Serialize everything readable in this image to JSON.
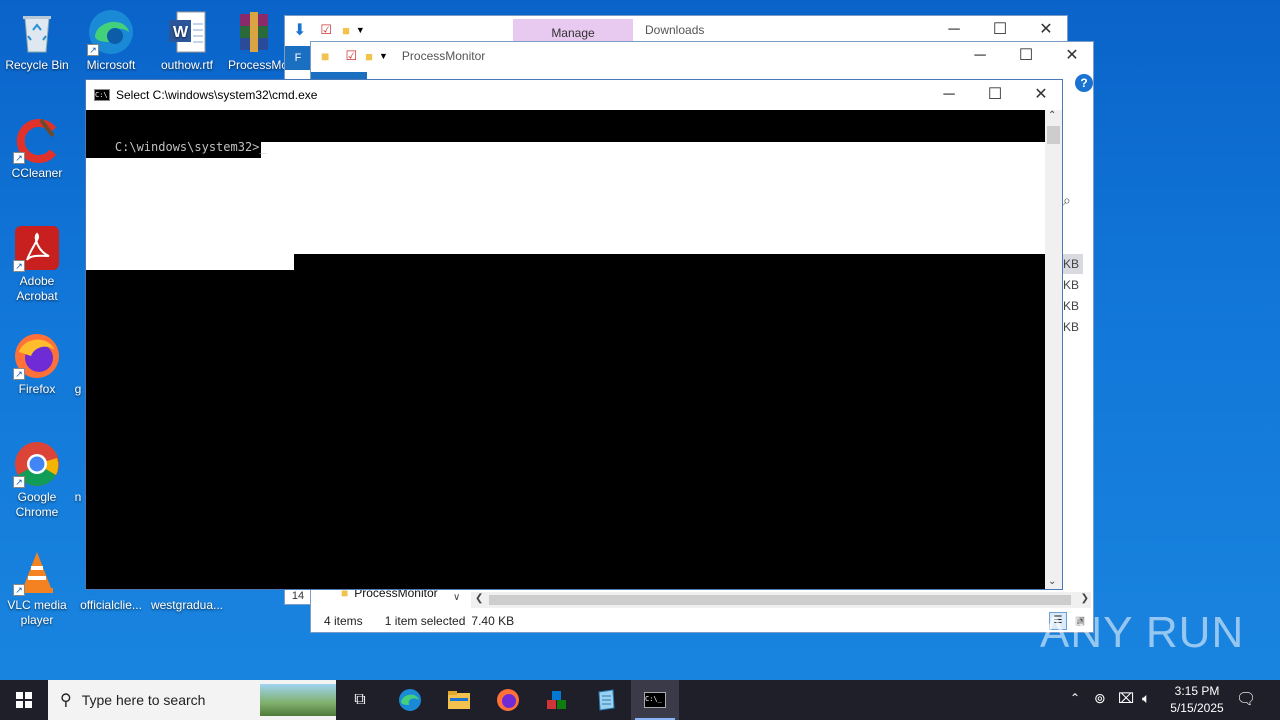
{
  "desktop": {
    "icons": [
      {
        "label": "Recycle Bin",
        "icon": "recycle-bin-icon"
      },
      {
        "label": "Microsoft Edge",
        "icon": "edge-icon"
      },
      {
        "label": "outhow.rtf",
        "icon": "word-document-icon"
      },
      {
        "label": "ProcessMc",
        "icon": "winrar-archive-icon"
      },
      {
        "label": "CCleaner",
        "icon": "ccleaner-icon"
      },
      {
        "label": "Adobe Acrobat",
        "icon": "acrobat-icon"
      },
      {
        "label": "Firefox",
        "icon": "firefox-icon"
      },
      {
        "label": "Google Chrome",
        "icon": "chrome-icon"
      },
      {
        "label": "VLC media player",
        "icon": "vlc-icon"
      },
      {
        "label": "officialclie...",
        "icon": "file-icon"
      },
      {
        "label": "westgradua...",
        "icon": "file-icon"
      }
    ],
    "partial_labels": [
      "g",
      "n"
    ]
  },
  "explorer_back": {
    "title": "Downloads",
    "ribbon_tab": "Manage",
    "file_tab_letter": "F"
  },
  "explorer_front": {
    "title": "ProcessMonitor",
    "list_row": {
      "num": "14",
      "name": "ProcessMonitor"
    },
    "size_cells": [
      "KB",
      "KB",
      "KB",
      "KB"
    ],
    "status": {
      "items": "4 items",
      "selected": "1 item selected",
      "size": "7.40 KB"
    },
    "help": "?"
  },
  "cmd": {
    "title": "Select C:\\windows\\system32\\cmd.exe",
    "prompt": "C:\\windows\\system32>",
    "cursor": "_"
  },
  "taskbar": {
    "search_placeholder": "Type here to search",
    "time": "3:15 PM",
    "date": "5/15/2025",
    "apps": [
      "task-view-icon",
      "edge-icon",
      "file-explorer-icon",
      "firefox-icon",
      "app-cubes-icon",
      "notepad-icon",
      "cmd-icon"
    ]
  },
  "watermark": "ANY RUN"
}
